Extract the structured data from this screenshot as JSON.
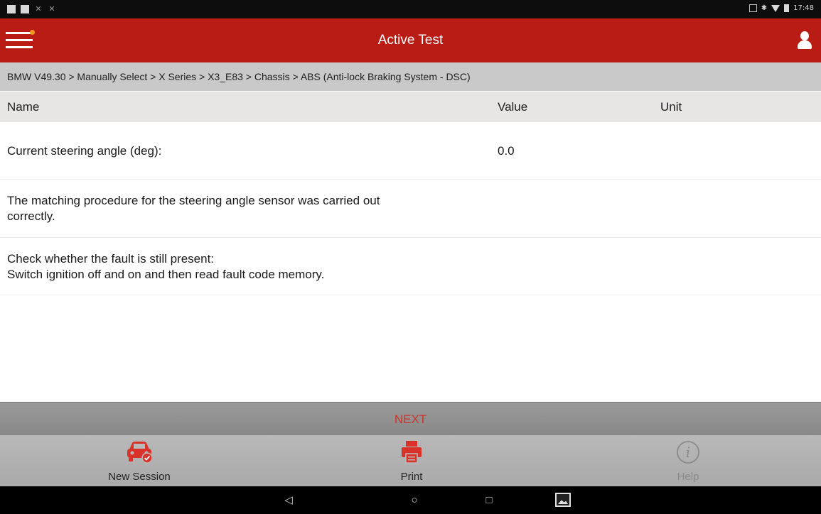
{
  "status_bar": {
    "time": "17:48"
  },
  "header": {
    "title": "Active Test",
    "notification_color": "#f39a1e",
    "brand_color": "#b81c14"
  },
  "breadcrumb": "BMW V49.30 > Manually Select > X Series > X3_E83 > Chassis > ABS (Anti-lock Braking System - DSC)",
  "table": {
    "columns": [
      "Name",
      "Value",
      "Unit"
    ],
    "rows": [
      {
        "name": "Current steering angle (deg):",
        "value": "0.0",
        "unit": ""
      }
    ]
  },
  "messages": [
    {
      "lines": [
        "The matching procedure for the steering angle sensor was carried out",
        "correctly."
      ]
    },
    {
      "lines": [
        "Check whether the fault is still present:",
        "Switch ignition off and on and then read fault code memory."
      ]
    }
  ],
  "next_label": "NEXT",
  "actions": [
    {
      "label": "New Session",
      "icon": "car-icon",
      "enabled": true
    },
    {
      "label": "Print",
      "icon": "printer-icon",
      "enabled": true
    },
    {
      "label": "Help",
      "icon": "info-icon",
      "enabled": false
    }
  ],
  "nav": {
    "back": "◁",
    "home": "○",
    "recent": "□"
  }
}
